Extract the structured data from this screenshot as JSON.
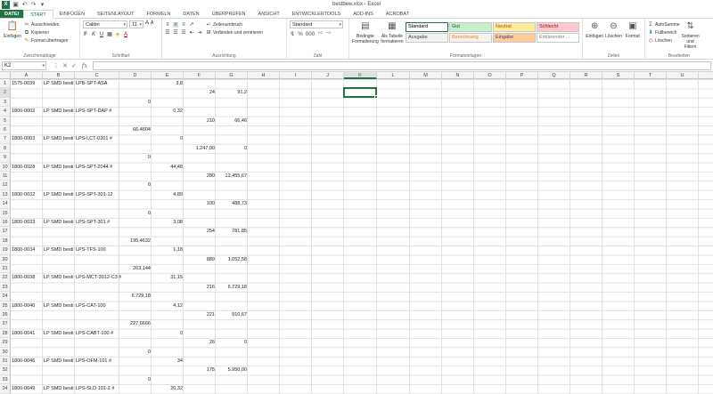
{
  "window": {
    "title": "bestbew.xlsx - Excel",
    "app_badge": "X"
  },
  "ribbon_tabs": [
    "DATEI",
    "START",
    "EINFÜGEN",
    "SEITENLAYOUT",
    "FORMELN",
    "DATEN",
    "ÜBERPRÜFEN",
    "ANSICHT",
    "ENTWICKLERTOOLS",
    "ADD-INS",
    "ACROBAT"
  ],
  "active_tab": "START",
  "clipboard": {
    "paste": "Einfügen",
    "cut": "Ausschneiden",
    "copy": "Kopieren",
    "format_painter": "Format übertragen",
    "label": "Zwischenablage"
  },
  "font": {
    "name": "Calibri",
    "size": "11",
    "label": "Schriftart",
    "bold": "F",
    "italic": "K",
    "underline": "U"
  },
  "alignment": {
    "wrap": "Zeilenumbruch",
    "merge": "Verbinden und zentrieren",
    "label": "Ausrichtung"
  },
  "number": {
    "format": "Standard",
    "percent": "%",
    "thousands": "000",
    "label": "Zahl"
  },
  "styles": {
    "conditional": "Bedingte Formatierung",
    "as_table": "Als Tabelle formatieren",
    "label": "Formatvorlagen",
    "items": [
      {
        "name": "Standard",
        "bg": "#ffffff",
        "fg": "#000000"
      },
      {
        "name": "Gut",
        "bg": "#c6efce",
        "fg": "#006100"
      },
      {
        "name": "Neutral",
        "bg": "#ffeb9c",
        "fg": "#9c5700"
      },
      {
        "name": "Schlecht",
        "bg": "#ffc7ce",
        "fg": "#9c0006"
      },
      {
        "name": "Ausgabe",
        "bg": "#f2f2f2",
        "fg": "#3f3f3f"
      },
      {
        "name": "Berechnung",
        "bg": "#f2f2f2",
        "fg": "#fa7d00"
      },
      {
        "name": "Eingabe",
        "bg": "#ffcc99",
        "fg": "#3f3f76"
      },
      {
        "name": "Erklärender ...",
        "bg": "#ffffff",
        "fg": "#7f7f7f"
      }
    ]
  },
  "cells_group": {
    "insert": "Einfügen",
    "delete": "Löschen",
    "format": "Format",
    "label": "Zellen"
  },
  "editing": {
    "autosum": "AutoSumme",
    "fill": "Füllbereich",
    "clear": "Löschen",
    "sort": "Sortieren und Filtern",
    "label": "Bearbeiten"
  },
  "formula_bar": {
    "name_box": "K2",
    "fx": "fx",
    "value": ""
  },
  "accent": "#217346",
  "columns": [
    "A",
    "B",
    "C",
    "D",
    "E",
    "F",
    "G",
    "H",
    "I",
    "J",
    "K",
    "L",
    "M",
    "N",
    "O",
    "P",
    "Q",
    "R",
    "S",
    "T",
    "U",
    "V"
  ],
  "selected_column": "K",
  "selected_row": 2,
  "rows": [
    1,
    2,
    3,
    4,
    5,
    6,
    7,
    8,
    9,
    10,
    11,
    12,
    13,
    14,
    15,
    16,
    17,
    18,
    19,
    20,
    21,
    22,
    23,
    24,
    25,
    26,
    27,
    28,
    29,
    30,
    31,
    32,
    33,
    34,
    35,
    36
  ],
  "cells": [
    {
      "r": 1,
      "c": "A",
      "v": "1575-0039"
    },
    {
      "r": 1,
      "c": "B",
      "v": "LP SMD besti"
    },
    {
      "r": 1,
      "c": "C",
      "v": "LPB-SPT-ASA"
    },
    {
      "r": 1,
      "c": "E",
      "v": "3,8",
      "n": true
    },
    {
      "r": 2,
      "c": "F",
      "v": "24",
      "n": true
    },
    {
      "r": 2,
      "c": "G",
      "v": "91,2",
      "n": true
    },
    {
      "r": 3,
      "c": "D",
      "v": "0",
      "n": true
    },
    {
      "r": 4,
      "c": "A",
      "v": "1800-0002"
    },
    {
      "r": 4,
      "c": "B",
      "v": "LP SMD besti"
    },
    {
      "r": 4,
      "c": "C",
      "v": "LPS-SPT-DAP #"
    },
    {
      "r": 4,
      "c": "E",
      "v": "0,32",
      "n": true
    },
    {
      "r": 5,
      "c": "F",
      "v": "210",
      "n": true
    },
    {
      "r": 5,
      "c": "G",
      "v": "66,46",
      "n": true
    },
    {
      "r": 6,
      "c": "D",
      "v": "66,4604",
      "n": true
    },
    {
      "r": 7,
      "c": "A",
      "v": "1800-0003"
    },
    {
      "r": 7,
      "c": "B",
      "v": "LP SMD besti"
    },
    {
      "r": 7,
      "c": "C",
      "v": "LPS-LCT-0201 #"
    },
    {
      "r": 7,
      "c": "E",
      "v": "0",
      "n": true
    },
    {
      "r": 8,
      "c": "F",
      "v": "1.247,00",
      "n": true
    },
    {
      "r": 8,
      "c": "G",
      "v": "0",
      "n": true
    },
    {
      "r": 9,
      "c": "D",
      "v": "0",
      "n": true
    },
    {
      "r": 10,
      "c": "A",
      "v": "1800-0028"
    },
    {
      "r": 10,
      "c": "B",
      "v": "LP SMD besti"
    },
    {
      "r": 10,
      "c": "C",
      "v": "LPS-SPT-2044 #"
    },
    {
      "r": 10,
      "c": "E",
      "v": "44,48",
      "n": true
    },
    {
      "r": 11,
      "c": "F",
      "v": "280",
      "n": true
    },
    {
      "r": 11,
      "c": "G",
      "v": "12.455,67",
      "n": true
    },
    {
      "r": 12,
      "c": "D",
      "v": "0",
      "n": true
    },
    {
      "r": 13,
      "c": "A",
      "v": "1800-0032"
    },
    {
      "r": 13,
      "c": "B",
      "v": "LP SMD besti"
    },
    {
      "r": 13,
      "c": "C",
      "v": "LPS-SPT-301-12"
    },
    {
      "r": 13,
      "c": "E",
      "v": "4,89",
      "n": true
    },
    {
      "r": 14,
      "c": "F",
      "v": "100",
      "n": true
    },
    {
      "r": 14,
      "c": "G",
      "v": "488,73",
      "n": true
    },
    {
      "r": 15,
      "c": "D",
      "v": "0",
      "n": true
    },
    {
      "r": 16,
      "c": "A",
      "v": "1800-0033"
    },
    {
      "r": 16,
      "c": "B",
      "v": "LP SMD besti"
    },
    {
      "r": 16,
      "c": "C",
      "v": "LPS-SPT-301 #"
    },
    {
      "r": 16,
      "c": "E",
      "v": "3,08",
      "n": true
    },
    {
      "r": 17,
      "c": "F",
      "v": "254",
      "n": true
    },
    {
      "r": 17,
      "c": "G",
      "v": "781,85",
      "n": true
    },
    {
      "r": 18,
      "c": "D",
      "v": "195,4632",
      "n": true
    },
    {
      "r": 19,
      "c": "A",
      "v": "1800-0034"
    },
    {
      "r": 19,
      "c": "B",
      "v": "LP SMD besti"
    },
    {
      "r": 19,
      "c": "C",
      "v": "LPS-TFS-100"
    },
    {
      "r": 19,
      "c": "E",
      "v": "1,18",
      "n": true
    },
    {
      "r": 20,
      "c": "F",
      "v": "889",
      "n": true
    },
    {
      "r": 20,
      "c": "G",
      "v": "1.052,58",
      "n": true
    },
    {
      "r": 21,
      "c": "D",
      "v": "263,144",
      "n": true
    },
    {
      "r": 22,
      "c": "A",
      "v": "1800-0038"
    },
    {
      "r": 22,
      "c": "B",
      "v": "LP SMD besti"
    },
    {
      "r": 22,
      "c": "C",
      "v": "LPS-MCT-3012-C3 #"
    },
    {
      "r": 22,
      "c": "E",
      "v": "31,15",
      "n": true
    },
    {
      "r": 23,
      "c": "F",
      "v": "216",
      "n": true
    },
    {
      "r": 23,
      "c": "G",
      "v": "6.729,18",
      "n": true
    },
    {
      "r": 24,
      "c": "D",
      "v": "6.729,18",
      "n": true
    },
    {
      "r": 25,
      "c": "A",
      "v": "1800-0040"
    },
    {
      "r": 25,
      "c": "B",
      "v": "LP SMD besti"
    },
    {
      "r": 25,
      "c": "C",
      "v": "LPS-CAT-100"
    },
    {
      "r": 25,
      "c": "E",
      "v": "4,12",
      "n": true
    },
    {
      "r": 26,
      "c": "F",
      "v": "221",
      "n": true
    },
    {
      "r": 26,
      "c": "G",
      "v": "910,67",
      "n": true
    },
    {
      "r": 27,
      "c": "D",
      "v": "227,6666",
      "n": true
    },
    {
      "r": 28,
      "c": "A",
      "v": "1800-0041"
    },
    {
      "r": 28,
      "c": "B",
      "v": "LP SMD besti"
    },
    {
      "r": 28,
      "c": "C",
      "v": "LPS-CABT-100 #"
    },
    {
      "r": 28,
      "c": "E",
      "v": "0",
      "n": true
    },
    {
      "r": 29,
      "c": "F",
      "v": "26",
      "n": true
    },
    {
      "r": 29,
      "c": "G",
      "v": "0",
      "n": true
    },
    {
      "r": 30,
      "c": "D",
      "v": "0",
      "n": true
    },
    {
      "r": 31,
      "c": "A",
      "v": "1800-0046"
    },
    {
      "r": 31,
      "c": "B",
      "v": "LP SMD besti"
    },
    {
      "r": 31,
      "c": "C",
      "v": "LPS-OFM-101 #"
    },
    {
      "r": 31,
      "c": "E",
      "v": "34",
      "n": true
    },
    {
      "r": 32,
      "c": "F",
      "v": "175",
      "n": true
    },
    {
      "r": 32,
      "c": "G",
      "v": "5.950,00",
      "n": true
    },
    {
      "r": 33,
      "c": "D",
      "v": "0",
      "n": true
    },
    {
      "r": 34,
      "c": "A",
      "v": "1800-0049"
    },
    {
      "r": 34,
      "c": "B",
      "v": "LP SMD besti"
    },
    {
      "r": 34,
      "c": "C",
      "v": "LPS-SLD-101-2 #"
    },
    {
      "r": 34,
      "c": "E",
      "v": "20,32",
      "n": true
    },
    {
      "r": 35,
      "c": "F",
      "v": "639",
      "n": true
    },
    {
      "r": 35,
      "c": "G",
      "v": "12.987,41",
      "n": true
    },
    {
      "r": 36,
      "c": "D",
      "v": "0",
      "n": true
    }
  ]
}
